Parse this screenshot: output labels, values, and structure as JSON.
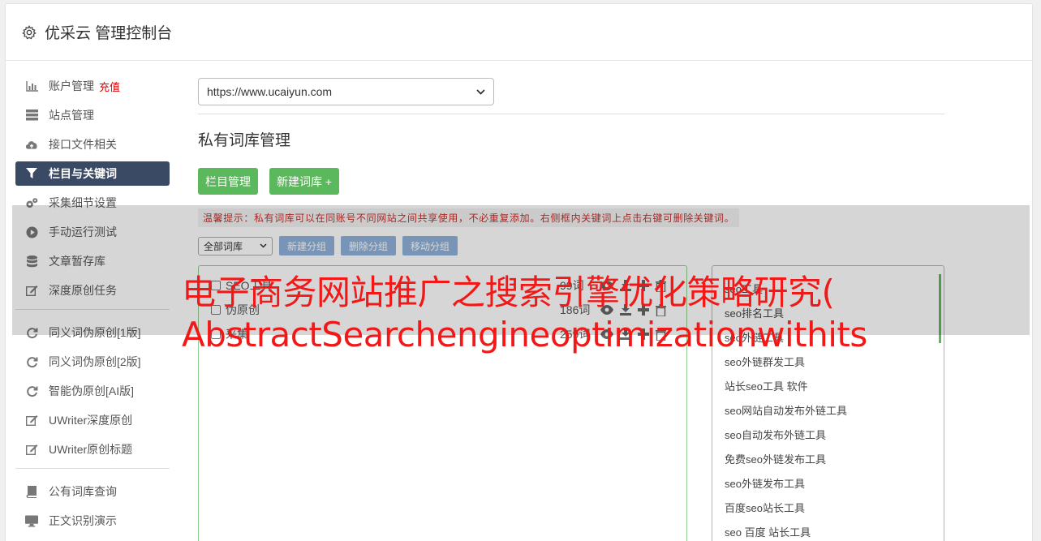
{
  "header": {
    "title": "优采云 管理控制台"
  },
  "sidebar": {
    "group1": [
      {
        "label": "账户管理",
        "badge": "充值",
        "icon": "bar-chart-icon"
      },
      {
        "label": "站点管理",
        "icon": "server-icon"
      },
      {
        "label": "接口文件相关",
        "icon": "cloud-upload-icon"
      },
      {
        "label": "栏目与关键词",
        "icon": "filter-icon",
        "active": true
      },
      {
        "label": "采集细节设置",
        "icon": "gears-icon"
      },
      {
        "label": "手动运行测试",
        "icon": "play-circle-icon"
      },
      {
        "label": "文章暂存库",
        "icon": "database-icon"
      },
      {
        "label": "深度原创任务",
        "icon": "edit-icon"
      }
    ],
    "group2": [
      {
        "label": "同义词伪原创[1版]",
        "icon": "refresh-icon"
      },
      {
        "label": "同义词伪原创[2版]",
        "icon": "refresh-icon"
      },
      {
        "label": "智能伪原创[AI版]",
        "icon": "refresh-icon"
      },
      {
        "label": "UWriter深度原创",
        "icon": "edit-icon"
      },
      {
        "label": "UWriter原创标题",
        "icon": "edit-icon"
      }
    ],
    "group3": [
      {
        "label": "公有词库查询",
        "icon": "book-icon"
      },
      {
        "label": "正文识别演示",
        "icon": "desktop-icon"
      }
    ]
  },
  "main": {
    "site_select": "https://www.ucaiyun.com",
    "section_title": "私有词库管理",
    "btn_column": "栏目管理",
    "btn_new_lib": "新建词库 +",
    "tip": "温馨提示：私有词库可以在同账号不同网站之间共享使用，不必重复添加。右侧框内关键词上点击右键可删除关键词。",
    "lib_select": "全部词库",
    "btn_new_group": "新建分组",
    "btn_del_group": "删除分组",
    "btn_move_group": "移动分组",
    "libraries": [
      {
        "name": "SEO工具",
        "count": "99词"
      },
      {
        "name": "伪原创",
        "count": "186词"
      },
      {
        "name": "采集",
        "count": "259词"
      }
    ],
    "keywords": [
      "seo工具",
      "seo排名工具",
      "seo外链工具",
      "seo外链群发工具",
      "站长seo工具 软件",
      "seo网站自动发布外链工具",
      "seo自动发布外链工具",
      "免费seo外链发布工具",
      "seo外链发布工具",
      "百度seo站长工具",
      "seo 百度 站长工具"
    ]
  },
  "overlay": {
    "line1": "电子商务网站推广之搜索引擎优化策略研究(",
    "line2": "AbstractSearchengineoptimizationwithits"
  }
}
